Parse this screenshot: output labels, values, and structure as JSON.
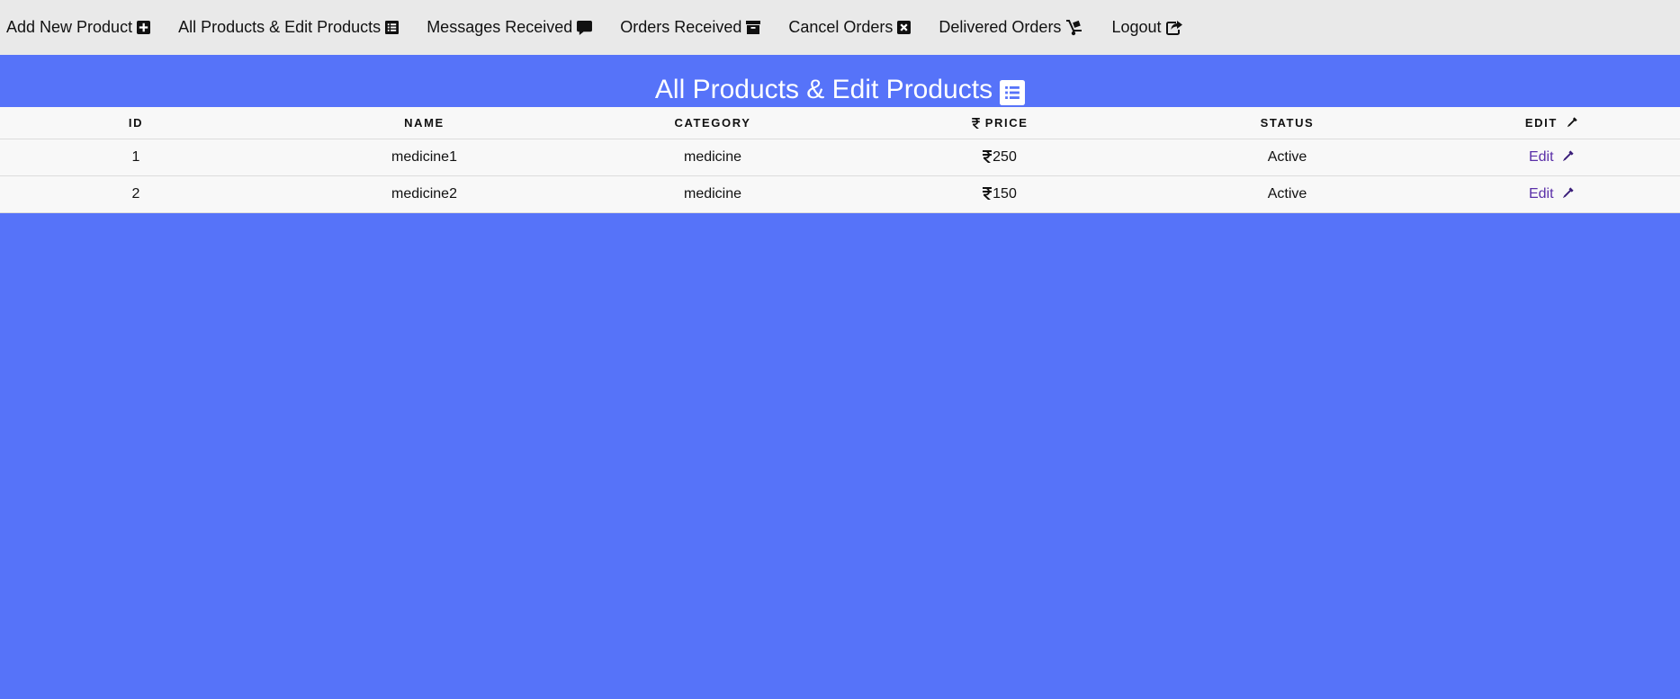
{
  "nav": {
    "items": [
      {
        "label": "Add New Product",
        "icon": "plus-square-icon"
      },
      {
        "label": "All Products & Edit Products",
        "icon": "list-alt-icon"
      },
      {
        "label": "Messages Received",
        "icon": "comment-icon"
      },
      {
        "label": "Orders Received",
        "icon": "archive-icon"
      },
      {
        "label": "Cancel Orders",
        "icon": "close-square-icon"
      },
      {
        "label": "Delivered Orders",
        "icon": "dolly-icon"
      },
      {
        "label": "Logout",
        "icon": "share-square-icon"
      }
    ]
  },
  "page": {
    "title": "All Products & Edit Products",
    "title_icon": "list-alt-icon",
    "background": "#5673f9"
  },
  "table": {
    "headers": {
      "id": "ID",
      "name": "NAME",
      "category": "CATEGORY",
      "price": "PRICE",
      "status": "STATUS",
      "edit": "EDIT"
    },
    "rows": [
      {
        "id": "1",
        "name": "medicine1",
        "category": "medicine",
        "price": "250",
        "status": "Active",
        "edit": "Edit"
      },
      {
        "id": "2",
        "name": "medicine2",
        "category": "medicine",
        "price": "150",
        "status": "Active",
        "edit": "Edit"
      }
    ]
  }
}
